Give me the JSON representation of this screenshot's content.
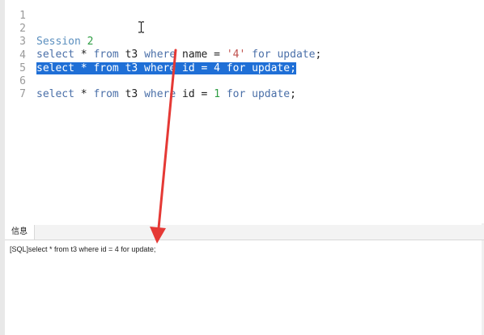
{
  "editor": {
    "lines": [
      {
        "num": "1",
        "tokens": []
      },
      {
        "num": "2",
        "tokens": [
          {
            "t": "Session ",
            "c": "cm"
          },
          {
            "t": "2",
            "c": "num"
          }
        ]
      },
      {
        "num": "3",
        "tokens": [
          {
            "t": "select",
            "c": "kw"
          },
          {
            "t": " * ",
            "c": "plain"
          },
          {
            "t": "from",
            "c": "kw"
          },
          {
            "t": " t3 ",
            "c": "plain"
          },
          {
            "t": "where",
            "c": "kw"
          },
          {
            "t": " name = ",
            "c": "plain"
          },
          {
            "t": "'4'",
            "c": "str"
          },
          {
            "t": " ",
            "c": "plain"
          },
          {
            "t": "for update",
            "c": "kw"
          },
          {
            "t": ";",
            "c": "plain"
          }
        ]
      },
      {
        "num": "4",
        "selected": true,
        "tokens": [
          {
            "t": "select * from t3 where id = 4 for update;",
            "c": "sel"
          }
        ]
      },
      {
        "num": "5",
        "tokens": []
      },
      {
        "num": "6",
        "tokens": [
          {
            "t": "select",
            "c": "kw"
          },
          {
            "t": " * ",
            "c": "plain"
          },
          {
            "t": "from",
            "c": "kw"
          },
          {
            "t": " t3 ",
            "c": "plain"
          },
          {
            "t": "where",
            "c": "kw"
          },
          {
            "t": " id = ",
            "c": "plain"
          },
          {
            "t": "1",
            "c": "num"
          },
          {
            "t": " ",
            "c": "plain"
          },
          {
            "t": "for update",
            "c": "kw"
          },
          {
            "t": ";",
            "c": "plain"
          }
        ]
      },
      {
        "num": "7",
        "tokens": []
      }
    ]
  },
  "tabs": [
    {
      "label": "信息",
      "active": true
    }
  ],
  "message": {
    "text": "[SQL]select * from t3 where id = 4 for update;"
  },
  "colors": {
    "selection": "#1f6fd6",
    "arrow": "#e53935",
    "keyword": "#4a6fa8",
    "number": "#2f9e44",
    "string": "#c0504d"
  }
}
